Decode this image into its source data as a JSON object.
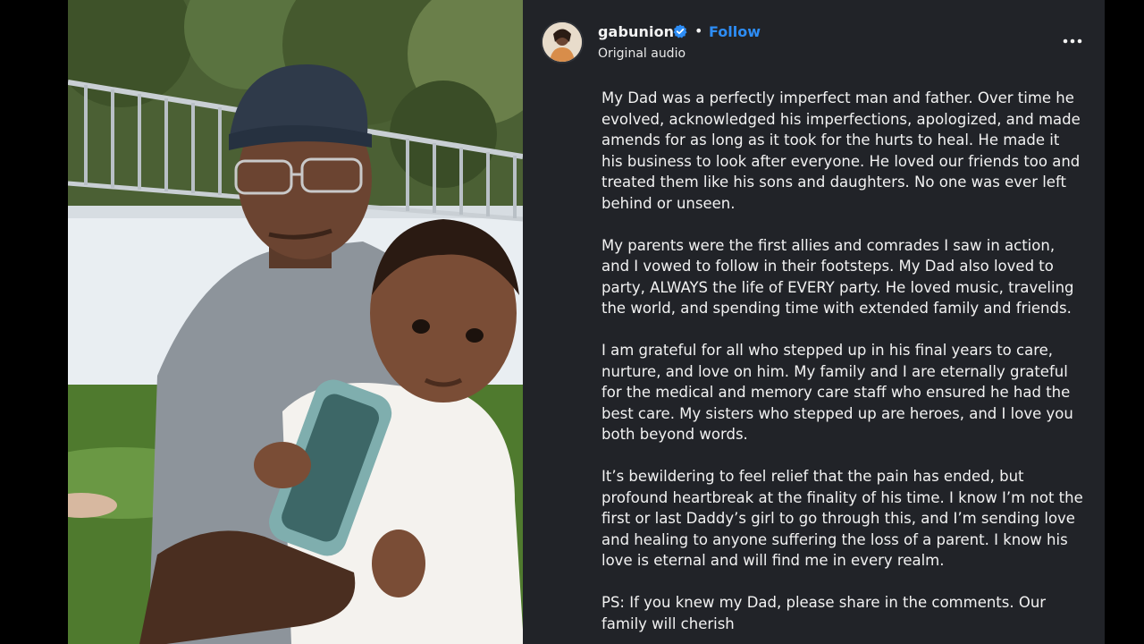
{
  "post": {
    "username": "gabunion",
    "separator": "•",
    "follow_label": "Follow",
    "audio_label": "Original audio",
    "verified": true,
    "more_icon": "more-horizontal-icon",
    "verified_icon": "verified-badge-icon"
  },
  "caption": {
    "paragraphs": [
      "My Dad was a perfectly imperfect man and father. Over time he evolved, acknowledged his imperfections, apologized, and made amends for as long as it took for the hurts to heal. He made it his business to look after everyone. He loved our friends too and treated them like his sons and daughters. No one was ever left behind or unseen.",
      "My parents were the first allies and comrades I saw in action, and I vowed to follow in their footsteps. My Dad also loved to party, ALWAYS the life of EVERY party. He loved music, traveling the world, and spending time with extended family and friends.",
      "I am grateful for all who stepped up in his final years to care, nurture, and love on him. My family and I are eternally grateful for the medical and memory care staff who ensured he had the best care. My sisters who stepped up are heroes, and I love you both beyond words.",
      "It’s bewildering to feel relief that the pain has ended, but profound heartbreak at the finality of his time. I know I’m not the first or last Daddy’s girl to go through this, and I’m sending love and healing to anyone suffering the loss of a parent. I know his love is eternal and will find me in every realm.",
      "PS: If you knew my Dad, please share in the comments. Our family will cherish"
    ]
  },
  "colors": {
    "panel_bg": "#212328",
    "follow": "#2d8df6",
    "verified": "#2d8df6",
    "text": "#f2f2f2"
  }
}
